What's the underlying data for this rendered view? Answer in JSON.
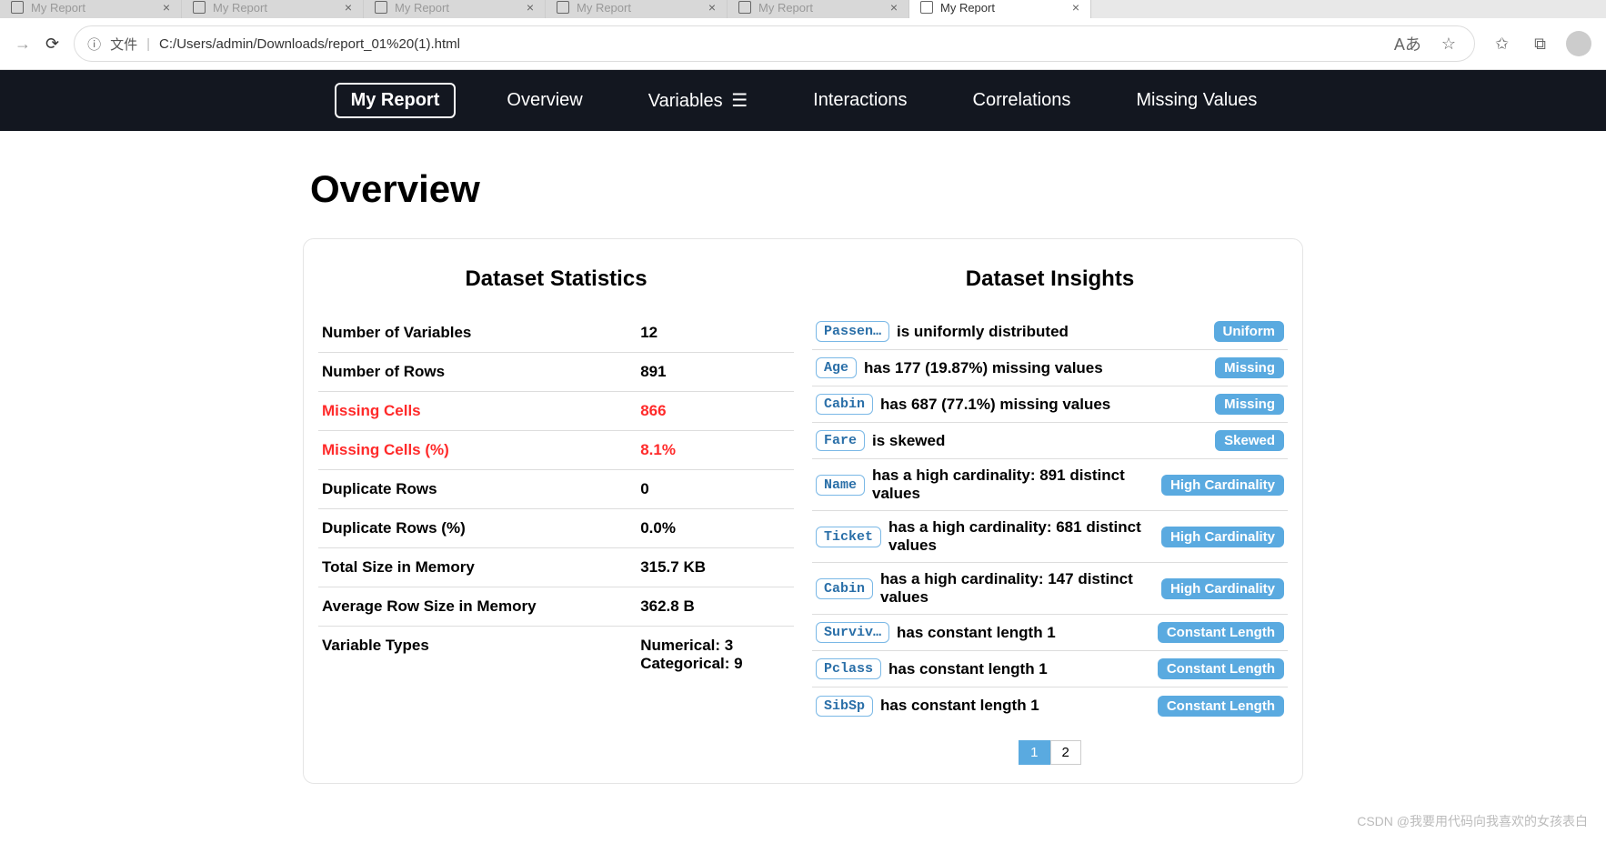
{
  "browser": {
    "tabs": [
      {
        "title": "My Report"
      },
      {
        "title": "My Report"
      },
      {
        "title": "My Report"
      },
      {
        "title": "My Report"
      },
      {
        "title": "My Report"
      },
      {
        "title": "My Report"
      }
    ],
    "addr_label": "文件",
    "url": "C:/Users/admin/Downloads/report_01%20(1).html",
    "translate_icon": "あ"
  },
  "nav": {
    "brand": "My Report",
    "items": [
      "Overview",
      "Variables",
      "Interactions",
      "Correlations",
      "Missing Values"
    ]
  },
  "page_title": "Overview",
  "stats_title": "Dataset Statistics",
  "stats": [
    {
      "label": "Number of Variables",
      "value": "12",
      "alert": false
    },
    {
      "label": "Number of Rows",
      "value": "891",
      "alert": false
    },
    {
      "label": "Missing Cells",
      "value": "866",
      "alert": true
    },
    {
      "label": "Missing Cells (%)",
      "value": "8.1%",
      "alert": true
    },
    {
      "label": "Duplicate Rows",
      "value": "0",
      "alert": false
    },
    {
      "label": "Duplicate Rows (%)",
      "value": "0.0%",
      "alert": false
    },
    {
      "label": "Total Size in Memory",
      "value": "315.7 KB",
      "alert": false
    },
    {
      "label": "Average Row Size in Memory",
      "value": "362.8 B",
      "alert": false
    }
  ],
  "var_types_label": "Variable Types",
  "var_types": [
    "Numerical: 3",
    "Categorical: 9"
  ],
  "insights_title": "Dataset Insights",
  "insights": [
    {
      "var": "Passen…",
      "text": "is uniformly distributed",
      "badge": "Uniform"
    },
    {
      "var": "Age",
      "text": "has 177 (19.87%) missing values",
      "badge": "Missing"
    },
    {
      "var": "Cabin",
      "text": "has 687 (77.1%) missing values",
      "badge": "Missing"
    },
    {
      "var": "Fare",
      "text": "is skewed",
      "badge": "Skewed"
    },
    {
      "var": "Name",
      "text": "has a high cardinality: 891 distinct values",
      "badge": "High Cardinality"
    },
    {
      "var": "Ticket",
      "text": "has a high cardinality: 681 distinct values",
      "badge": "High Cardinality"
    },
    {
      "var": "Cabin",
      "text": "has a high cardinality: 147 distinct values",
      "badge": "High Cardinality"
    },
    {
      "var": "Surviv…",
      "text": "has constant length 1",
      "badge": "Constant Length"
    },
    {
      "var": "Pclass",
      "text": "has constant length 1",
      "badge": "Constant Length"
    },
    {
      "var": "SibSp",
      "text": "has constant length 1",
      "badge": "Constant Length"
    }
  ],
  "pagination": [
    "1",
    "2"
  ],
  "watermark": "CSDN @我要用代码向我喜欢的女孩表白"
}
